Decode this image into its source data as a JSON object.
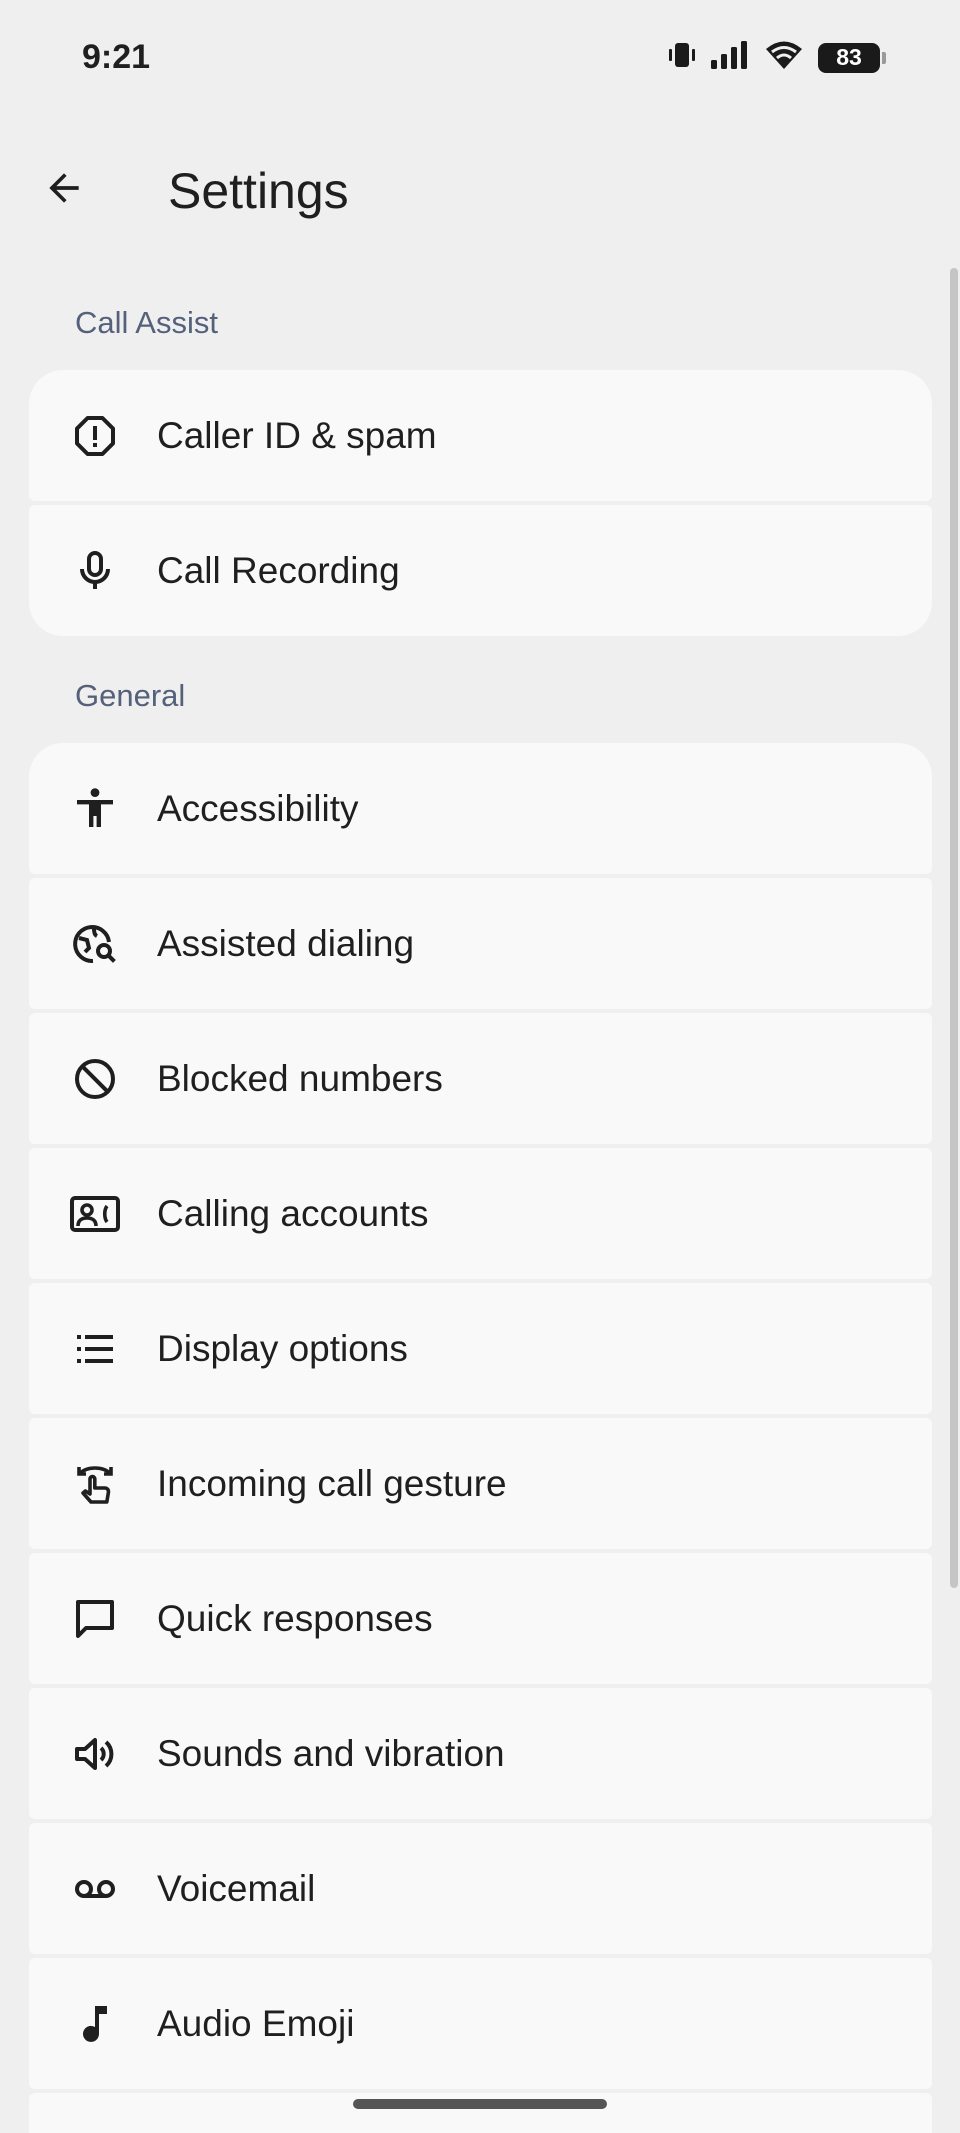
{
  "status_bar": {
    "time": "9:21",
    "battery": "83",
    "icons": [
      "vibrate-icon",
      "signal-icon",
      "wifi-icon",
      "battery-icon"
    ]
  },
  "app_bar": {
    "title": "Settings",
    "back_icon": "arrow-back-icon"
  },
  "sections": [
    {
      "header": "Call Assist",
      "items": [
        {
          "label": "Caller ID & spam",
          "icon": "report-icon"
        },
        {
          "label": "Call Recording",
          "icon": "mic-icon"
        }
      ]
    },
    {
      "header": "General",
      "items": [
        {
          "label": "Accessibility",
          "icon": "accessibility-icon"
        },
        {
          "label": "Assisted dialing",
          "icon": "travel-explore-icon"
        },
        {
          "label": "Blocked numbers",
          "icon": "block-icon"
        },
        {
          "label": "Calling accounts",
          "icon": "contact-phone-icon"
        },
        {
          "label": "Display options",
          "icon": "list-icon"
        },
        {
          "label": "Incoming call gesture",
          "icon": "swipe-gesture-icon"
        },
        {
          "label": "Quick responses",
          "icon": "chat-bubble-icon"
        },
        {
          "label": "Sounds and vibration",
          "icon": "volume-icon"
        },
        {
          "label": "Voicemail",
          "icon": "voicemail-icon"
        },
        {
          "label": "Audio Emoji",
          "icon": "music-note-icon"
        }
      ]
    }
  ],
  "colors": {
    "background": "#efefef",
    "card": "#f9f9f9",
    "section_header": "#55617a",
    "text": "#1f1f1f"
  }
}
